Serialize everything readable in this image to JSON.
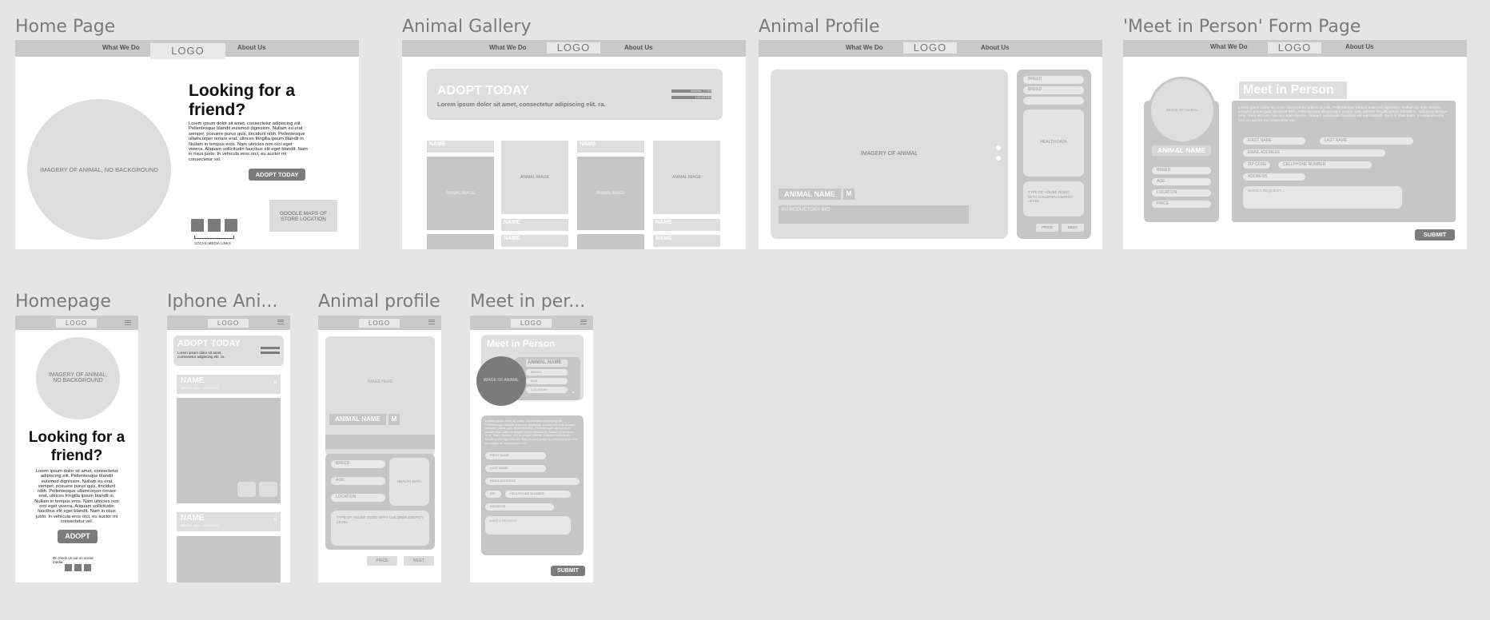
{
  "frames": {
    "home_page": {
      "title": "Home Page",
      "nav": {
        "what_we_do": "What We Do",
        "logo": "LOGO",
        "about_us": "About Us"
      },
      "image_placeholder": "IMAGERY OF ANIMAL, NO BACKGROUND",
      "headline": "Looking for a friend?",
      "body": "Lorem ipsum dolor sit amet, consectetur adipiscing elit. Pellentesque blandit euismod dignissim. Nullam eu erat semper, posuere purus quis, tincidunt nibh. Pellentesque ullamcorper ornare erat, ultrices fringilla ipsum blandit in. Nullam in tempus eros. Nam ultricies non orci eget viverra. Aliquam sollicitudin faucibus elit eget blandit. Nam in risus justo. In vehicula eros orci, eu auctor mi consectetur vel.",
      "cta": "ADOPT TODAY",
      "maps": "GOOGLE MAPS OF STORE LOCATION",
      "social": "SOCIAL MEDIA LINKS"
    },
    "animal_gallery": {
      "title": "Animal Gallery",
      "nav": {
        "what_we_do": "What We Do",
        "logo": "LOGO",
        "about_us": "About Us"
      },
      "banner_title": "ADOPT TODAY",
      "banner_sub": "Lorem ipsum dolor sit amet, consectetur adipiscing elit. ra.",
      "filters": [
        "ANIMAL TYPE",
        "LOCATION"
      ],
      "card_name": "NAME",
      "card_image": "ANIMAL IMAGE"
    },
    "animal_profile": {
      "title": "Animal Profile",
      "nav": {
        "what_we_do": "What We Do",
        "logo": "LOGO",
        "about_us": "About Us"
      },
      "image_placeholder": "IMAGERY OF ANIMAL",
      "animal_name": "ANIMAL NAME",
      "sex": "M",
      "bio": "INTRODUCTORY BIO",
      "side_fields": [
        "BREED",
        "BREED"
      ],
      "health": "HEALTH DATA",
      "temperament": "TYPE OF HOUSE GOOD WITH CHILDREN ENERGY LEVEL",
      "price": "PRICE",
      "meet": "MEET"
    },
    "meet_form": {
      "title": "'Meet in Person' Form Page",
      "nav": {
        "what_we_do": "What We Do",
        "logo": "LOGO",
        "about_us": "About Us"
      },
      "image_placeholder": "IMAGE OF ANIMAL",
      "animal_name": "ANIMAL NAME",
      "side_fields": [
        "BREED",
        "AGE",
        "LOCATION",
        "PRICE"
      ],
      "form_title": "Meet in Person",
      "form_text": "Lorem ipsum dolor sit amet, consectetur adipiscing elit. Pellentesque blandit euismod dignissim. Nullam eu erat semper, posuere purus quis, tincidunt nibh. Pellentesque ullamcorper ornare erat, ultrices fringilla ipsum blandit in. Nullam in tempus eros. Nam ultricies non orci eget viverra. Aliquam sollicitudin faucibus elit eget blandit. Nam in risus justo. In vehicula eros orci, eu auctor mi consectetur vel.",
      "fields": [
        "FIRST NAME",
        "LAST NAME",
        "EMAIL ADDRESS",
        "ZIP CODE",
        "CELLPHONE NUMBER",
        "ADDRESS",
        "MAKE A REQUEST..."
      ],
      "submit": "SUBMIT"
    },
    "homepage_mobile": {
      "title": "Homepage",
      "logo": "LOGO",
      "image_placeholder": "IMAGERY OF ANIMAL, NO BACKGROUND",
      "headline": "Looking for a friend?",
      "body": "Lorem ipsum dolor sit amet, consectetur adipiscing elit. Pellentesque blandit euismod dignissim. Nullam eu erat semper, posuere purus quis, tincidunt nibh. Pellentesque ullamcorper ornare erat, ultrices fringilla ipsum blandit in. Nullam in tempus eros. Nam ultricies non orci eget viverra. Aliquam sollicitudin faucibus elit eget blandit. Nam in risus justo. In vehicula eros orci, eu auctor mi consectetur vel.",
      "cta": "ADOPT",
      "social": "Or check us out on social media"
    },
    "iphone_gallery": {
      "title": "Iphone Ani...",
      "logo": "LOGO",
      "banner_title": "ADOPT TODAY",
      "banner_sub": "Lorem ipsum dolor sit amet, consectetur adipiscing elit. ra.",
      "card_name": "NAME",
      "card_sub": "BREED, AGE, LOCATION"
    },
    "animal_profile_mobile": {
      "title": "Animal profile",
      "logo": "LOGO",
      "image_placeholder": "IMAGE HERE",
      "animal_name": "ANIMAL NAME",
      "sex": "M",
      "fields": [
        "BREED",
        "AGE",
        "LOCATION"
      ],
      "health": "HEALTH DATA",
      "temperament": "TYPE OF HOUSE GOOD WITH CHILDREN ENERGY LEVEL",
      "price": "PRICE",
      "meet": "MEET"
    },
    "meet_mobile": {
      "title": "Meet in per...",
      "logo": "LOGO",
      "form_title": "Meet in Person",
      "image_placeholder": "IMAGE OF ANIMAL",
      "animal_name": "ANIMAL NAME",
      "side_fields": [
        "BREED",
        "AGE",
        "LOCATION"
      ],
      "form_text": "Lorem ipsum dolor sit amet, consectetur adipiscing elit. Pellentesque blandit euismod dignissim. Nullam eu erat semper, posuere purus quis, tincidunt nibh. Pellentesque ullamcorper ornare erat, ultrices fringilla ipsum blandit in. Nullam in tempus eros. Nam ultricies non orci eget viverra. Aliquam sollicitudin faucibus elit eget blandit. Nam in risus justo. In vehicula eros orci, eu auctor mi consectetur vel.",
      "fields": [
        "FIRST NAME",
        "LAST NAME",
        "EMAIL ADDRESS",
        "ZIP",
        "CELLPHONE NUMBER",
        "ADDRESS",
        "MAKE A REQUEST..."
      ],
      "submit": "SUBMIT"
    }
  },
  "colors": {
    "canvas": "#e5e5e5",
    "frame": "#ffffff",
    "nav": "#c9c9c9",
    "light_gray": "#dedede",
    "mid_gray": "#c6c6c6",
    "dark_gray": "#7b7b7b",
    "title": "#7a7a7a"
  }
}
